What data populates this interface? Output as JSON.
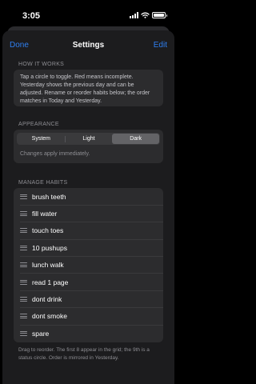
{
  "status": {
    "time": "3:05"
  },
  "nav": {
    "done_label": "Done",
    "title": "Settings",
    "edit_label": "Edit"
  },
  "how_it_works": {
    "header": "HOW IT WORKS",
    "text": "Tap a circle to toggle. Red means incomplete. Yesterday shows the previous day and can be adjusted. Rename or reorder habits below; the order matches in Today and Yesterday."
  },
  "appearance": {
    "header": "APPEARANCE",
    "options": [
      "System",
      "Light",
      "Dark"
    ],
    "selected": "Dark",
    "note": "Changes apply immediately."
  },
  "habits": {
    "header": "MANAGE HABITS",
    "items": [
      "brush teeth",
      "fill water",
      "touch toes",
      "10 pushups",
      "lunch walk",
      "read 1 page",
      "dont drink",
      "dont smoke",
      "spare"
    ],
    "footer": "Drag to reorder. The first 8 appear in the grid; the 9th is a status circle. Order is mirrored in Yesterday."
  },
  "icons": {
    "drag": "drag-handle-icon",
    "signal": "cellular-signal-icon",
    "wifi": "wifi-icon",
    "battery": "battery-icon"
  },
  "colors": {
    "accent": "#2f7ff0",
    "sheet_bg": "#1c1c1e",
    "card_bg": "#2c2c2e"
  }
}
